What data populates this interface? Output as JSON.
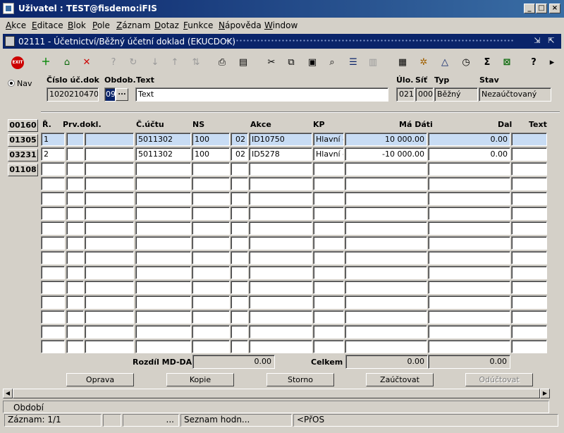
{
  "window": {
    "title": "Uživatel : TEST@fisdemo:iFIS"
  },
  "menu": [
    "Akce",
    "Editace",
    "Blok",
    "Pole",
    "Záznam",
    "Dotaz",
    "Funkce",
    "Nápověda",
    "Window"
  ],
  "form": {
    "title": "02111 - Účetnictví/Běžný účetní doklad (EKUCDOK)"
  },
  "toolbar": {
    "exit_label": "EXIT"
  },
  "nav": {
    "label": "Nav",
    "buttons": [
      "00160",
      "01305",
      "03231",
      "01108"
    ]
  },
  "header": {
    "labels": {
      "cislo": "Číslo úč.dok",
      "obdob": "Obdob.",
      "text": "Text",
      "ulo": "Úlo.",
      "sit": "Síť",
      "typ": "Typ",
      "stav": "Stav"
    },
    "values": {
      "cislo": "1020210470",
      "obdob": "09",
      "obdob_btn": "...",
      "text": "Text",
      "ulo": "021",
      "sit": "000",
      "typ": "Běžný",
      "stav": "Nezaúčtovaný"
    }
  },
  "grid": {
    "columns": [
      "Ř.",
      "Prv.dokl.",
      "Č.účtu",
      "NS",
      "Akce",
      "KP",
      "Má Dáti",
      "Dal",
      "Text"
    ],
    "rows": [
      {
        "r": "1",
        "prv": "",
        "ucet": "5011302",
        "ns": "100",
        "ns2": "02",
        "akce": "ID10750",
        "kp": "Hlavní či",
        "madati": "10 000.00",
        "dal": "0.00",
        "text": ""
      },
      {
        "r": "2",
        "prv": "",
        "ucet": "5011302",
        "ns": "100",
        "ns2": "02",
        "akce": "ID5278",
        "kp": "Hlavní či",
        "madati": "-10 000.00",
        "dal": "0.00",
        "text": ""
      }
    ]
  },
  "totals": {
    "rozdil_label": "Rozdíl MD-DAL",
    "rozdil_value": "0.00",
    "celkem_label": "Celkem",
    "celkem_md": "0.00",
    "celkem_dal": "0.00"
  },
  "buttons": {
    "oprava": "Oprava",
    "kopie": "Kopie",
    "storno": "Storno",
    "zauctovat": "Zaúčtovat",
    "oductovat": "Odúčtovat"
  },
  "status": {
    "line1": "Období",
    "zaznam": "Záznam: 1/1",
    "seg3": "...",
    "seg4": "Seznam hodn...",
    "seg5": "<PřOS"
  }
}
